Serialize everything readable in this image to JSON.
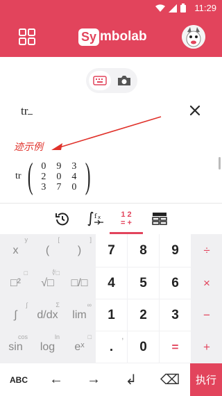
{
  "status_bar": {
    "time": "11:29"
  },
  "app": {
    "logo_prefix": "Sy",
    "logo_rest": "mbolab"
  },
  "editor": {
    "input_text": "tr",
    "annotation": "迹示例",
    "operator": "tr",
    "matrix": [
      [
        "0",
        "9",
        "3"
      ],
      [
        "2",
        "0",
        "4"
      ],
      [
        "3",
        "7",
        "0"
      ]
    ]
  },
  "tabs": {
    "numbers_top": "1 2",
    "numbers_bottom": "= +"
  },
  "keypad": {
    "rows": [
      [
        "x",
        "(",
        ")",
        "7",
        "8",
        "9",
        "÷"
      ],
      [
        "□²",
        "√□",
        "□/□",
        "4",
        "5",
        "6",
        "×"
      ],
      [
        "∫",
        "d/dx",
        "lim",
        "1",
        "2",
        "3",
        "−"
      ],
      [
        "sin",
        "log",
        "eˣ",
        ".",
        "0",
        "=",
        "+"
      ]
    ],
    "row_sups": [
      [
        "y",
        "[",
        "]",
        "",
        "",
        "",
        ""
      ],
      [
        "□",
        "∜□",
        "",
        "",
        "",
        "",
        ""
      ],
      [
        "∫",
        "Σ",
        "∞",
        "",
        "",
        "",
        ""
      ],
      [
        "cos",
        "ln",
        "□",
        ",",
        "",
        "",
        ""
      ]
    ],
    "bottom": {
      "abc": "ABC",
      "left": "←",
      "right": "→",
      "enter": "↲",
      "backspace": "⌫",
      "exec": "执行"
    }
  },
  "colors": {
    "brand": "#e2445c",
    "annotation": "#e0312a"
  }
}
